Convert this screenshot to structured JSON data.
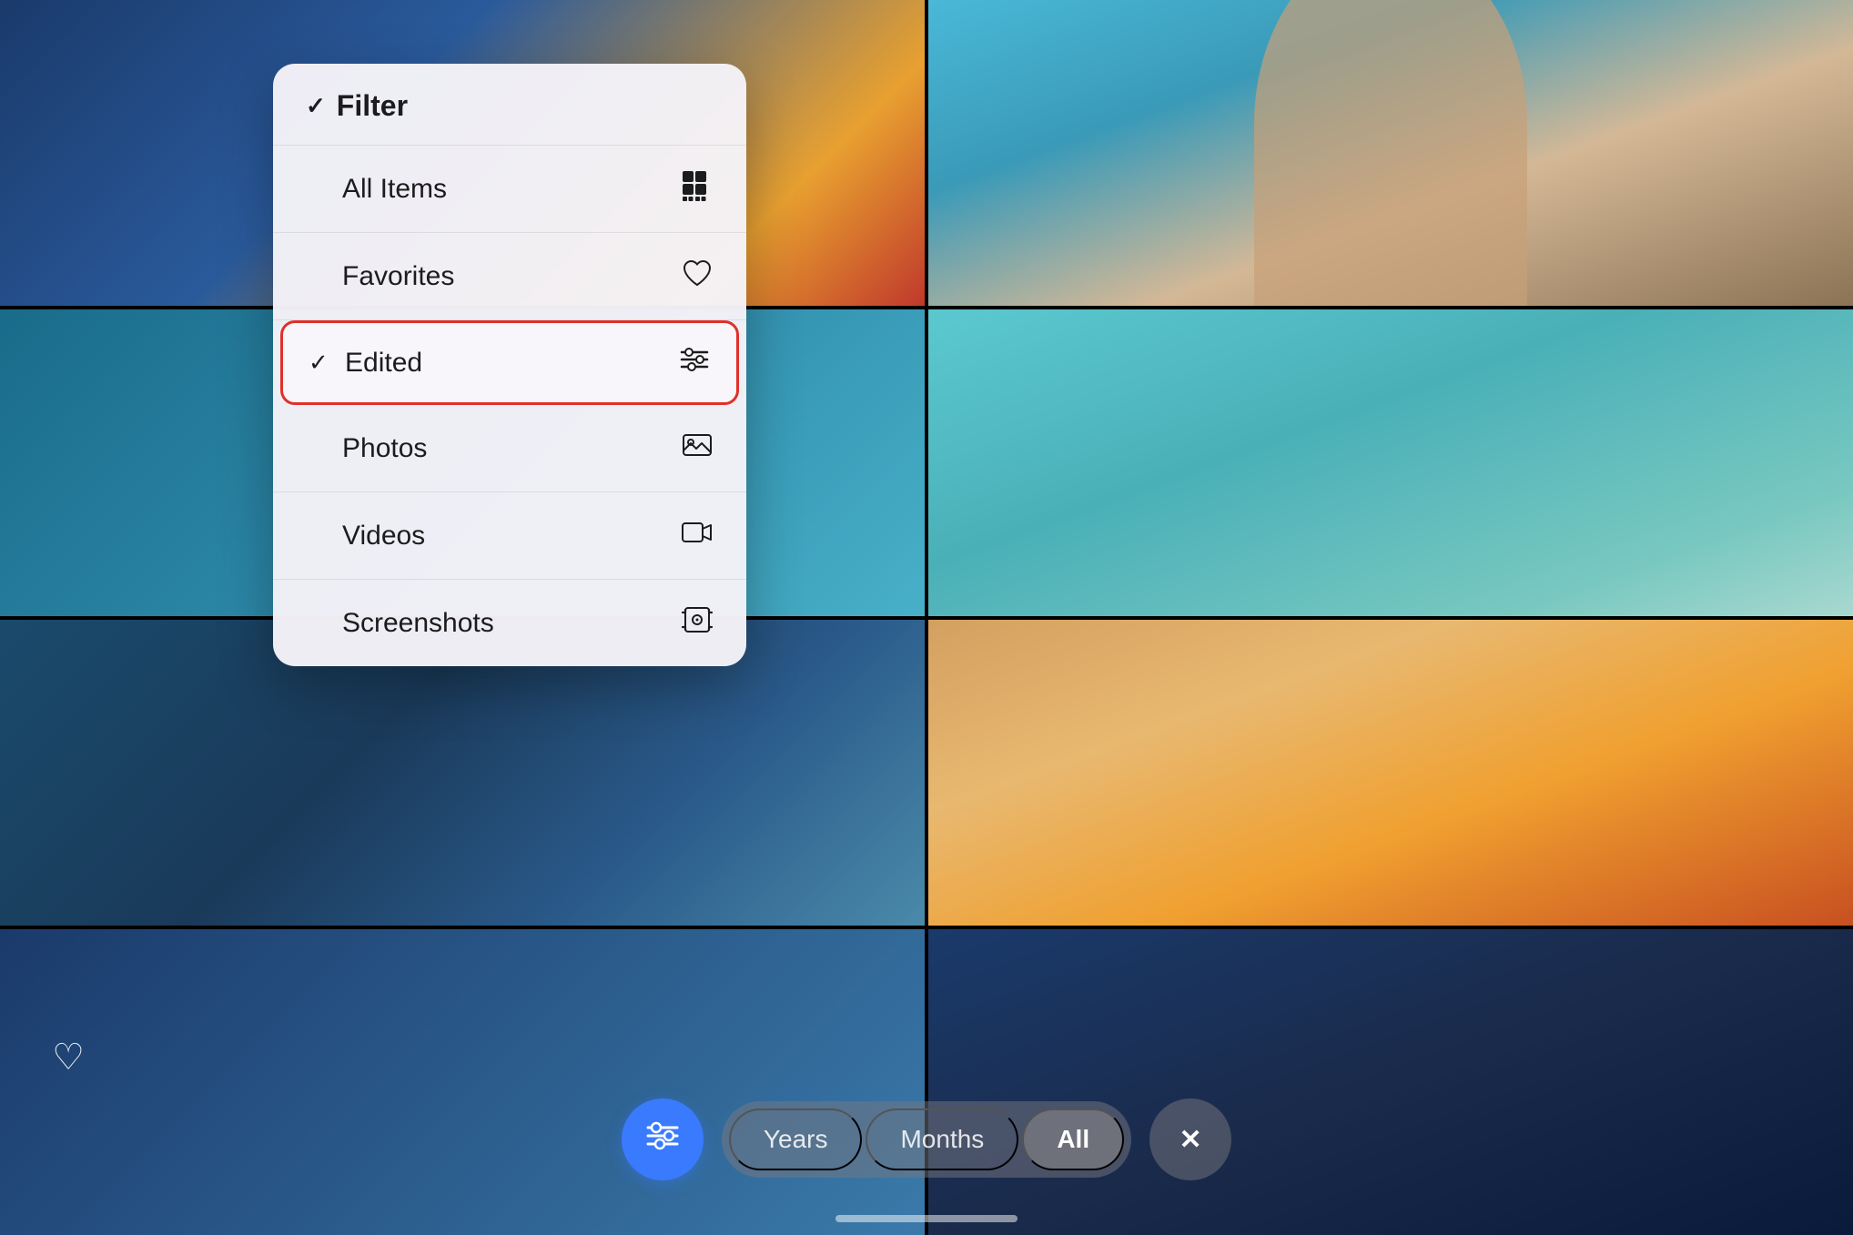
{
  "filter": {
    "header_chevron": "›",
    "title": "Filter",
    "items": [
      {
        "id": "all-items",
        "label": "All Items",
        "icon": "grid",
        "checked": false
      },
      {
        "id": "favorites",
        "label": "Favorites",
        "icon": "heart",
        "checked": false
      },
      {
        "id": "edited",
        "label": "Edited",
        "icon": "sliders",
        "checked": true,
        "highlighted": true
      },
      {
        "id": "photos",
        "label": "Photos",
        "icon": "photo",
        "checked": false
      },
      {
        "id": "videos",
        "label": "Videos",
        "icon": "video",
        "checked": false
      },
      {
        "id": "screenshots",
        "label": "Screenshots",
        "icon": "screenshot",
        "checked": false
      }
    ]
  },
  "toolbar": {
    "filter_fab_label": "⚙",
    "time_options": [
      {
        "label": "Years",
        "active": false
      },
      {
        "label": "Months",
        "active": false
      },
      {
        "label": "All",
        "active": true
      }
    ],
    "close_label": "✕"
  }
}
